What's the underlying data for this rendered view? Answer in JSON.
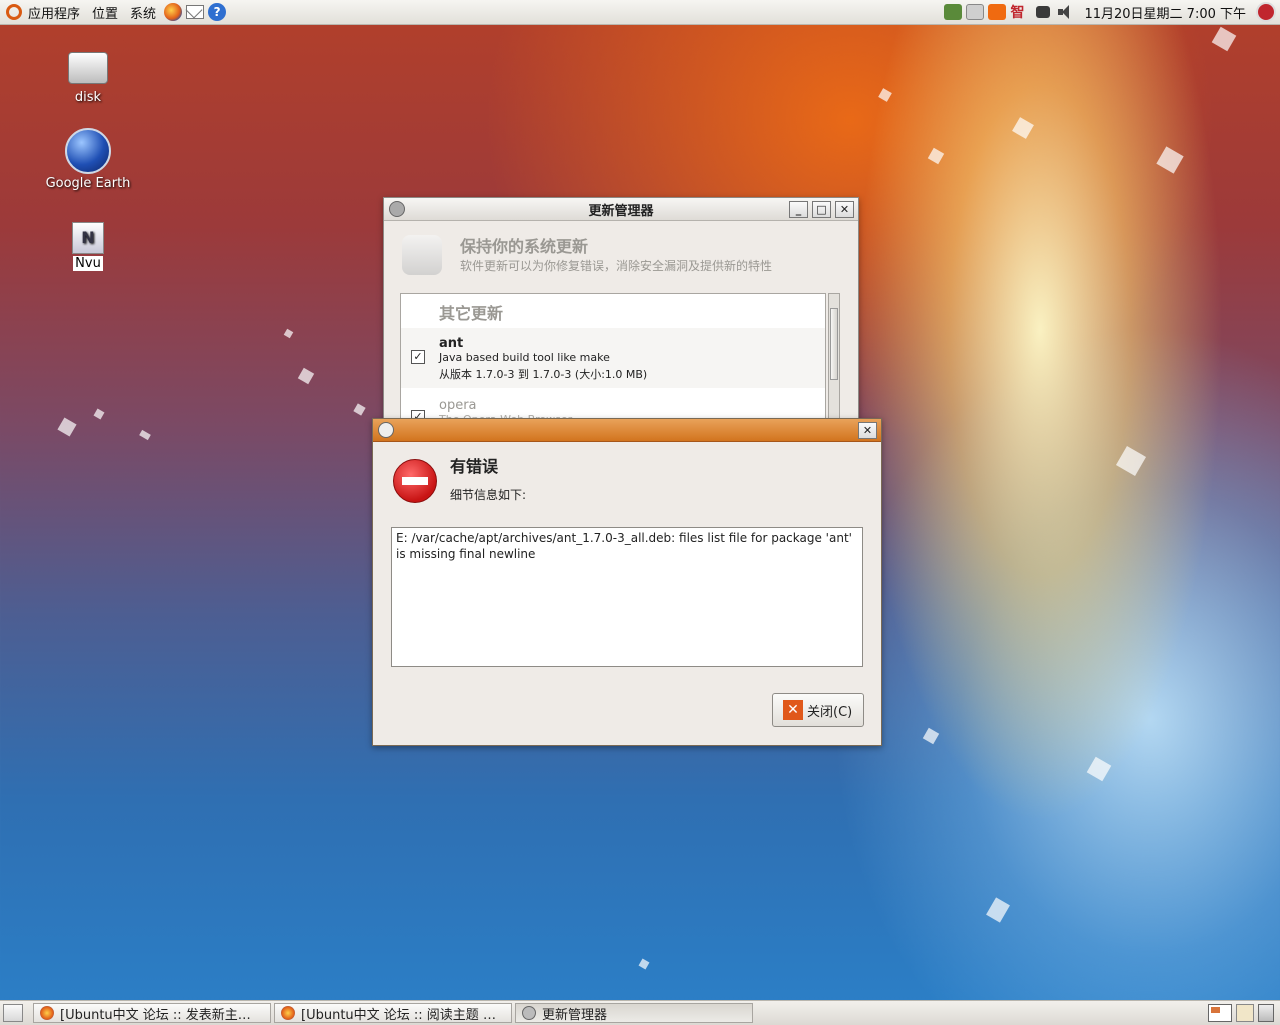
{
  "top_panel": {
    "menu_applications": "应用程序",
    "menu_places": "位置",
    "menu_system": "系统",
    "tray_ime_label": "智",
    "clock": "11月20日星期二  7:00 下午"
  },
  "desktop_icons": [
    {
      "label": "disk"
    },
    {
      "label": "Google Earth"
    },
    {
      "label": "Nvu"
    }
  ],
  "update_manager": {
    "title": "更新管理器",
    "header_title": "保持你的系统更新",
    "header_subtitle": "软件更新可以为你修复错误，消除安全漏洞及提供新的特性",
    "section_title": "其它更新",
    "packages": [
      {
        "name": "ant",
        "desc": "Java based build tool like make",
        "version": "从版本 1.7.0-3 到 1.7.0-3 (大小:1.0 MB)",
        "checked": true
      },
      {
        "name": "opera",
        "desc": "The Opera Web Browser",
        "checked": true
      }
    ]
  },
  "error_dialog": {
    "heading": "有错误",
    "subheading": "细节信息如下:",
    "details": "E: /var/cache/apt/archives/ant_1.7.0-3_all.deb: files list file for package 'ant' is missing final newline",
    "close_label": "关闭(C)"
  },
  "taskbar": {
    "items": [
      {
        "label": "[Ubuntu中文 论坛 :: 发表新主…"
      },
      {
        "label": "[Ubuntu中文 论坛 :: 阅读主题 …"
      },
      {
        "label": "更新管理器"
      }
    ]
  },
  "colors": {
    "accent_orange": "#d86a1c",
    "error_red": "#cc1a1a"
  }
}
